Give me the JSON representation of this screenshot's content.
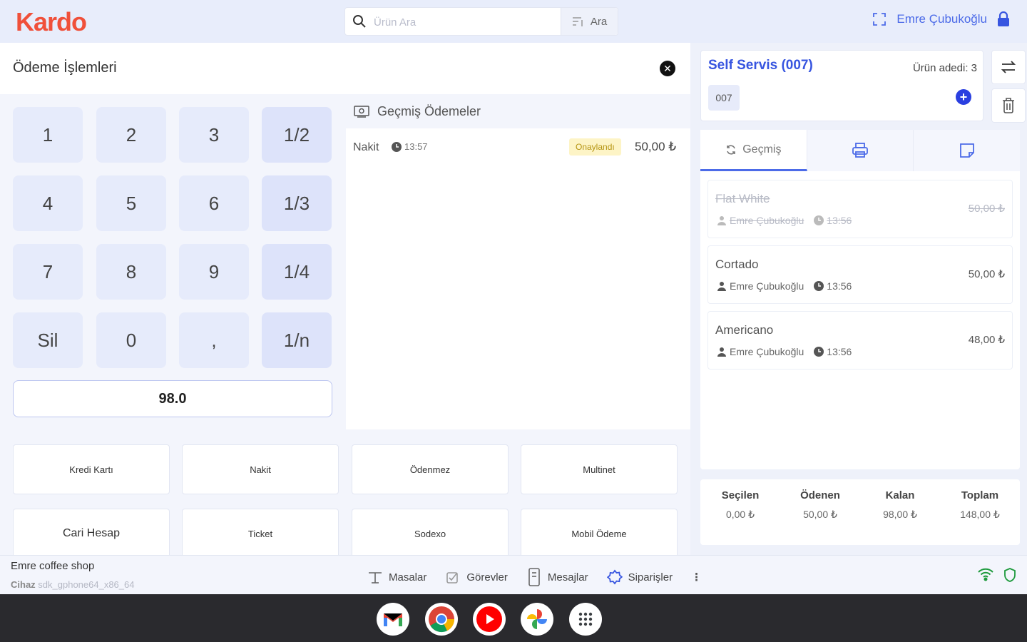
{
  "brand": {
    "logo": "Kardo",
    "accent": "#f0503a"
  },
  "search": {
    "placeholder": "Ürün Ara",
    "button_label": "Ara"
  },
  "user": {
    "name": "Emre Çubukoğlu"
  },
  "payment": {
    "title": "Ödeme İşlemleri",
    "keys": [
      "1",
      "2",
      "3",
      "1/2",
      "4",
      "5",
      "6",
      "1/3",
      "7",
      "8",
      "9",
      "1/4",
      "Sil",
      "0",
      ",",
      "1/n"
    ],
    "amount": "98.0",
    "history_title": "Geçmiş Ödemeler",
    "history": [
      {
        "method": "Nakit",
        "time": "13:57",
        "status": "Onaylandı",
        "amount": "50,00 ₺"
      }
    ],
    "methods": [
      "Kredi Kartı",
      "Nakit",
      "Ödenmez",
      "Multinet",
      "Cari Hesap",
      "Ticket",
      "Sodexo",
      "Mobil Ödeme"
    ]
  },
  "order": {
    "title": "Self Servis (007)",
    "count_label": "Ürün adedi: 3",
    "tag": "007",
    "tabs": {
      "history": "Geçmiş"
    },
    "items": [
      {
        "name": "Flat White",
        "user": "Emre Çubukoğlu",
        "time": "13:56",
        "price": "50,00 ₺",
        "struck": true
      },
      {
        "name": "Cortado",
        "user": "Emre Çubukoğlu",
        "time": "13:56",
        "price": "50,00 ₺",
        "struck": false
      },
      {
        "name": "Americano",
        "user": "Emre Çubukoğlu",
        "time": "13:56",
        "price": "48,00 ₺",
        "struck": false
      }
    ],
    "totals": [
      {
        "label": "Seçilen",
        "value": "0,00 ₺"
      },
      {
        "label": "Ödenen",
        "value": "50,00 ₺"
      },
      {
        "label": "Kalan",
        "value": "98,00 ₺"
      },
      {
        "label": "Toplam",
        "value": "148,00 ₺"
      }
    ]
  },
  "statusbar": {
    "shop": "Emre coffee shop",
    "device_label": "Cihaz",
    "device": "sdk_gphone64_x86_64",
    "nav": [
      "Masalar",
      "Görevler",
      "Mesajlar",
      "Siparişler"
    ]
  },
  "dock": [
    "gmail-icon",
    "chrome-icon",
    "youtube-icon",
    "photos-icon",
    "apps-icon"
  ]
}
